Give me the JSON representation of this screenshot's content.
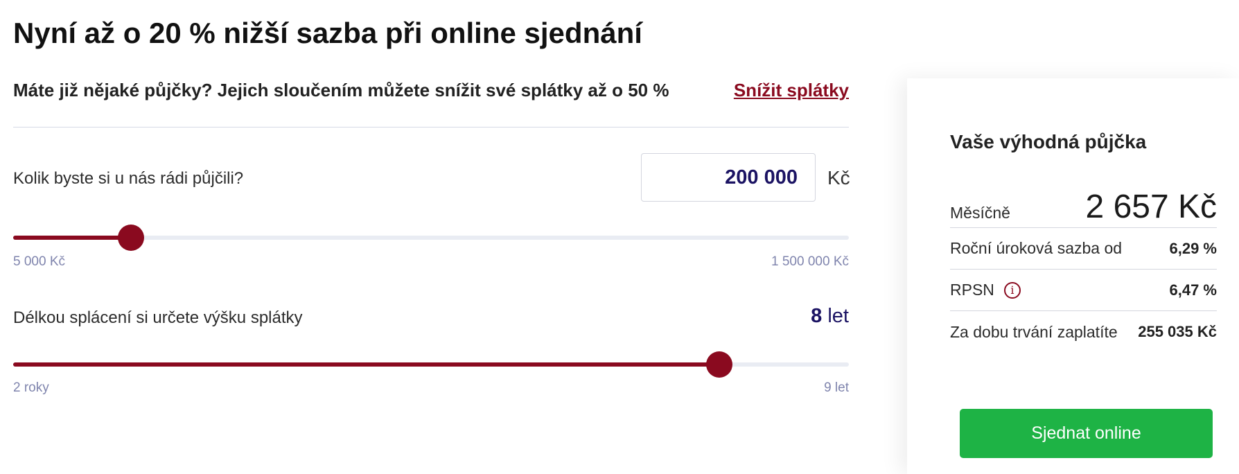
{
  "headline": "Nyní až o 20 % nižší sazba při online sjednání",
  "consolidation": {
    "text": "Máte již nějaké půjčky? Jejich sloučením můžete snížit své splátky až o 50 %",
    "link": "Snížit splátky"
  },
  "amount": {
    "question": "Kolik byste si u nás rádi půjčili?",
    "value": "200 000",
    "currency": "Kč",
    "slider_min_label": "5 000 Kč",
    "slider_max_label": "1 500 000 Kč",
    "slider_fraction": 0.141
  },
  "term": {
    "question": "Délkou splácení si určete výšku splátky",
    "value": "8",
    "unit": "let",
    "slider_min_label": "2 roky",
    "slider_max_label": "9 let",
    "slider_fraction": 0.845
  },
  "summary": {
    "title": "Vaše výhodná půjčka",
    "monthly_label": "Měsíčně",
    "monthly_value": "2 657 Kč",
    "rate_label": "Roční úroková sazba od",
    "rate_value": "6,29 %",
    "rpsn_label": "RPSN",
    "rpsn_value": "6,47 %",
    "info_icon": "info-circle-icon",
    "total_label": "Za dobu trvání zaplatíte",
    "total_value": "255 035 Kč",
    "cta_label": "Sjednat online"
  },
  "colors": {
    "accent": "#8a0a1f",
    "navy": "#1b1363",
    "cta": "#1eb345"
  }
}
